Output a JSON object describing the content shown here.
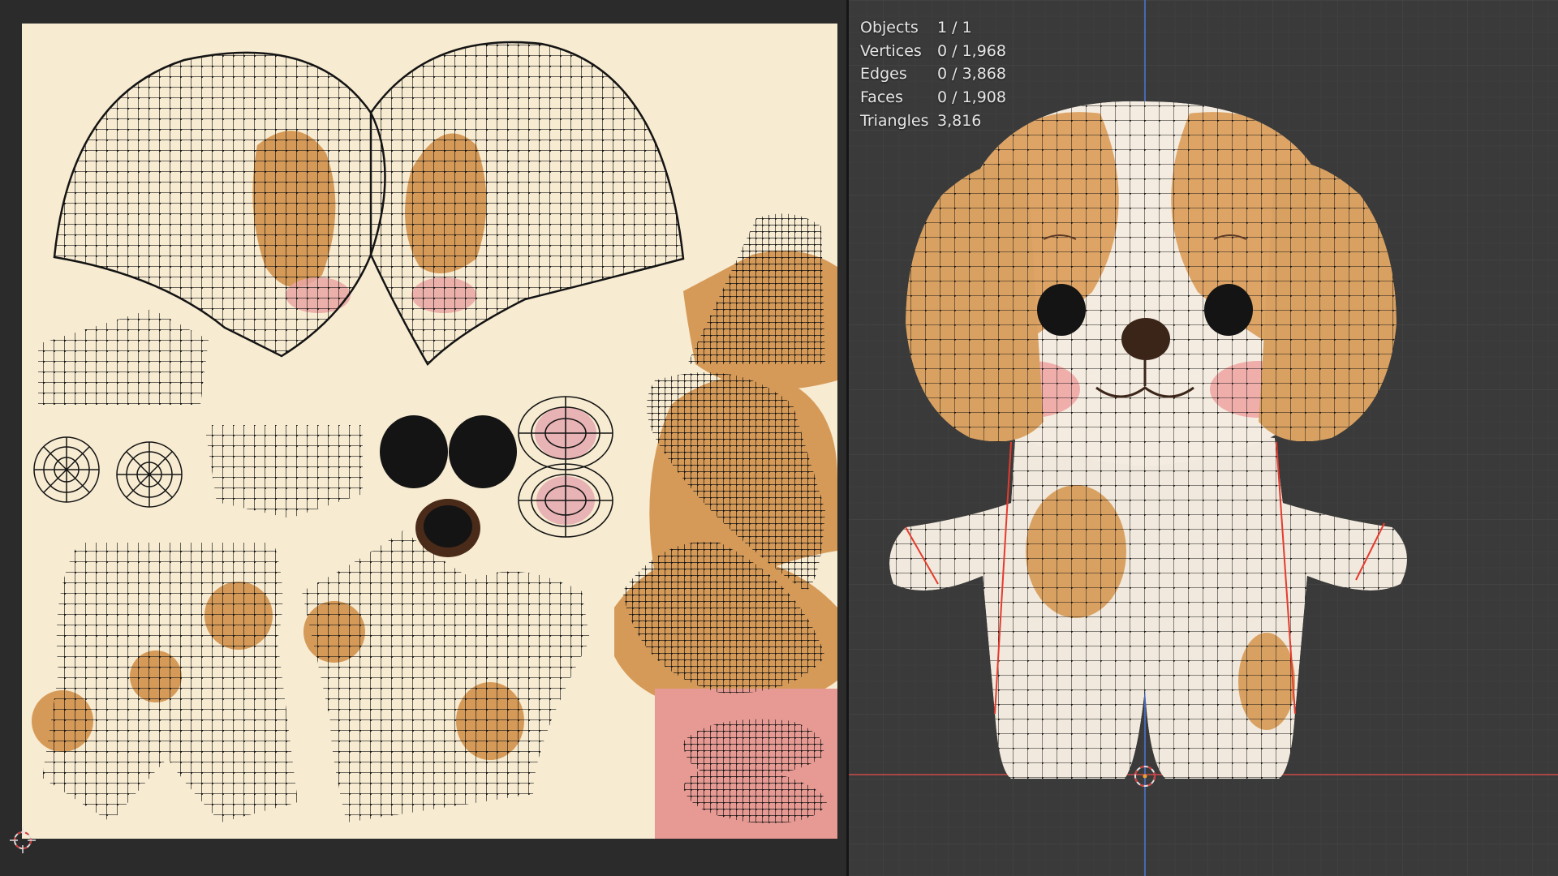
{
  "colors": {
    "uv_background": "#f7ebd1",
    "tan_patch": "#d69a58",
    "pink_blush": "#e99f98",
    "body_white": "#f4ece0",
    "mesh_wire": "#141414",
    "viewport_bg": "#3a3a3a",
    "grid_line": "#474747",
    "x_axis": "#b94848",
    "z_axis": "#4a6ec0",
    "seam": "#e53b2e"
  },
  "uv_editor": {
    "canvas_icon": "uv-grid-image"
  },
  "viewport": {
    "model_icon": "puppy-mesh",
    "stats": [
      {
        "label": "Objects",
        "value": "1 / 1"
      },
      {
        "label": "Vertices",
        "value": "0 / 1,968"
      },
      {
        "label": "Edges",
        "value": "0 / 3,868"
      },
      {
        "label": "Faces",
        "value": "0 / 1,908"
      },
      {
        "label": "Triangles",
        "value": "3,816"
      }
    ]
  }
}
